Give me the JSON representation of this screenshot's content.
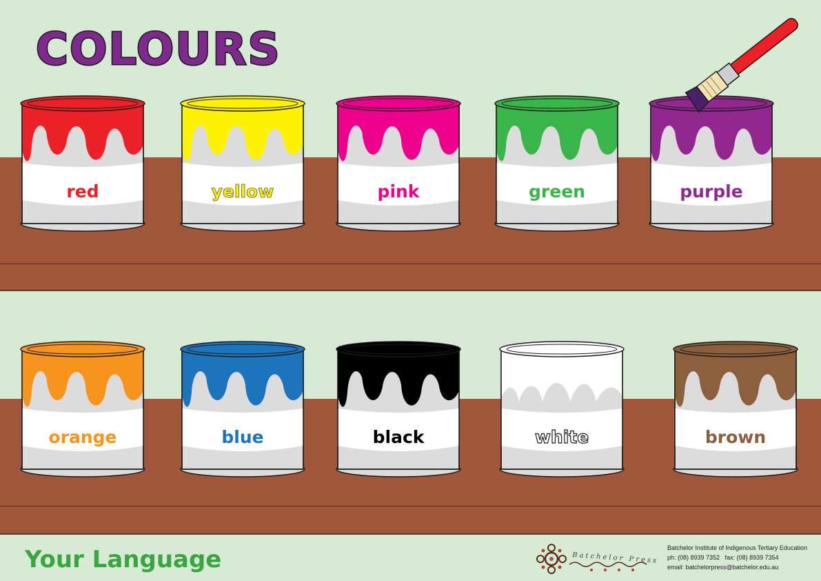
{
  "poster": {
    "title": "COLOURS",
    "footer_language": "Your Language"
  },
  "colors": {
    "background": "#d7ead3",
    "shelf": "#a0573a",
    "title_fill": "#7d2a8c",
    "footer_text": "#3aa541",
    "can_body": "#ffffff",
    "can_shade": "#dcdcdc"
  },
  "paints": [
    {
      "label": "red",
      "color": "#ec2027"
    },
    {
      "label": "yellow",
      "color": "#fff200"
    },
    {
      "label": "pink",
      "color": "#ec008c"
    },
    {
      "label": "green",
      "color": "#39b54a"
    },
    {
      "label": "purple",
      "color": "#92278f"
    },
    {
      "label": "orange",
      "color": "#f7941d"
    },
    {
      "label": "blue",
      "color": "#1c75bc"
    },
    {
      "label": "black",
      "color": "#000000"
    },
    {
      "label": "white",
      "color": "#ffffff"
    },
    {
      "label": "brown",
      "color": "#8b5e3c"
    }
  ],
  "icons": {
    "paintbrush": "paintbrush-icon",
    "logo": "batchelor-press-logo"
  },
  "publisher": {
    "logo_text": "Batchelor Press",
    "name": "Batchelor Institute of Indigenous Tertiary Education",
    "phone": "ph: (08) 8939 7352   fax: (08) 8939 7354",
    "email": "email: batchelorpress@batchelor.edu.au"
  }
}
